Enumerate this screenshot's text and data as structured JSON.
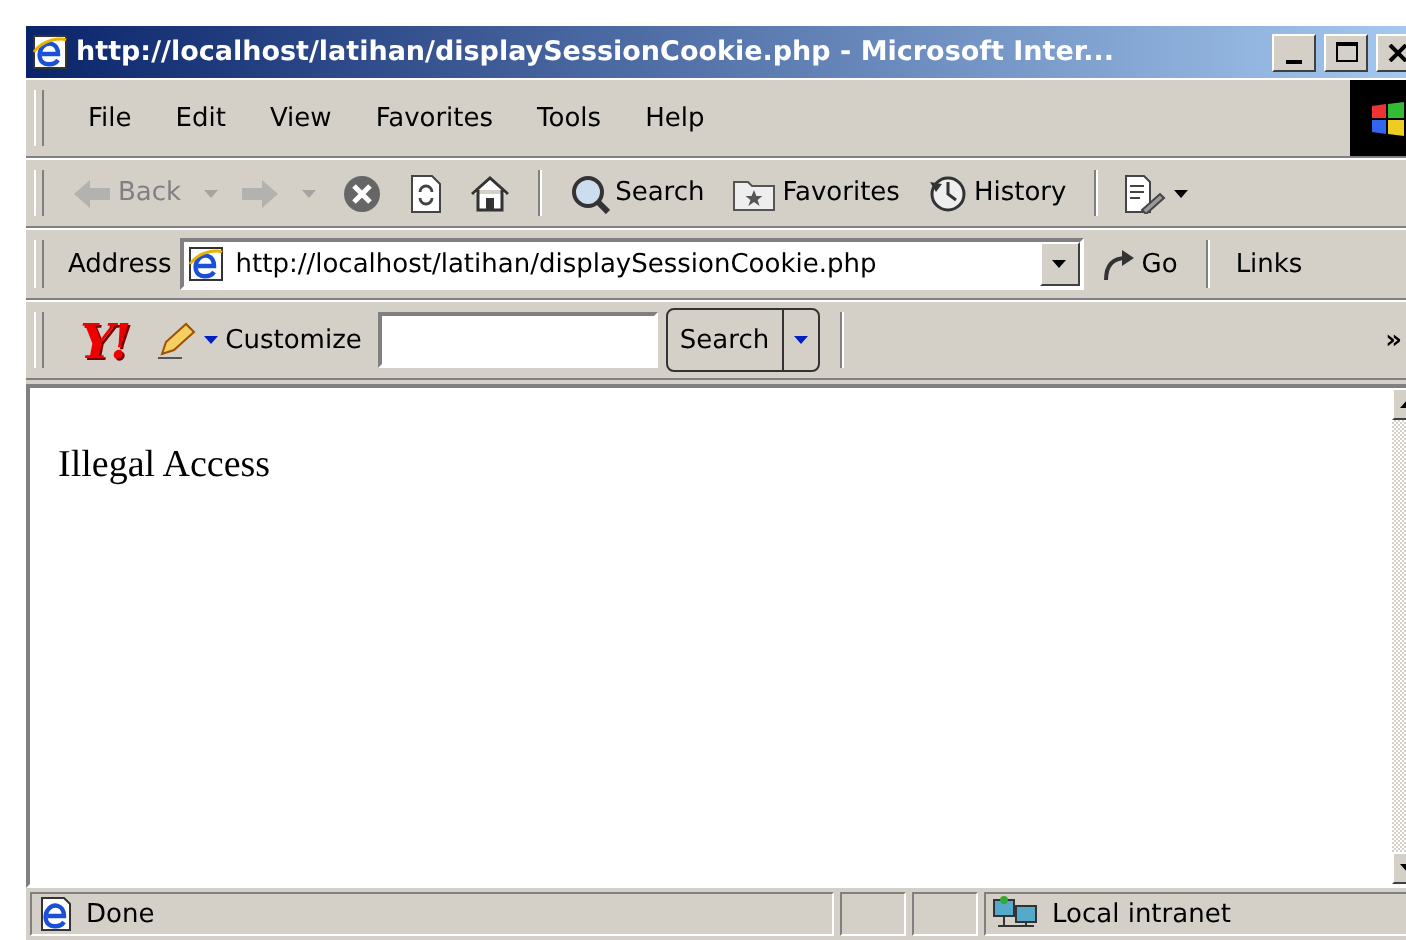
{
  "window": {
    "title": "http://localhost/latihan/displaySessionCookie.php - Microsoft Inter..."
  },
  "menu": [
    {
      "label": "File"
    },
    {
      "label": "Edit"
    },
    {
      "label": "View"
    },
    {
      "label": "Favorites"
    },
    {
      "label": "Tools"
    },
    {
      "label": "Help"
    }
  ],
  "toolbar": [
    {
      "kind": "back",
      "label": "Back",
      "disabled": true
    },
    {
      "kind": "forward",
      "disabled": true
    },
    {
      "kind": "stop",
      "disabled": false
    },
    {
      "kind": "refresh",
      "disabled": false
    },
    {
      "kind": "home",
      "disabled": false
    },
    {
      "kind": "separator"
    },
    {
      "kind": "search",
      "label": "Search",
      "disabled": false
    },
    {
      "kind": "favorites",
      "label": "Favorites",
      "disabled": false
    },
    {
      "kind": "history",
      "label": "History",
      "disabled": false
    },
    {
      "kind": "separator"
    },
    {
      "kind": "edit",
      "disabled": false
    }
  ],
  "address_bar": {
    "label": "Address",
    "url": "http://localhost/latihan/displaySessionCookie.php",
    "go": "Go",
    "links": "Links"
  },
  "yahoo_bar": {
    "logo": "Y!",
    "customize": "Customize",
    "search_button": "Search",
    "more": "»"
  },
  "page": {
    "text": "Illegal Access"
  },
  "status_bar": {
    "text": "Done",
    "zone": "Local intranet"
  }
}
